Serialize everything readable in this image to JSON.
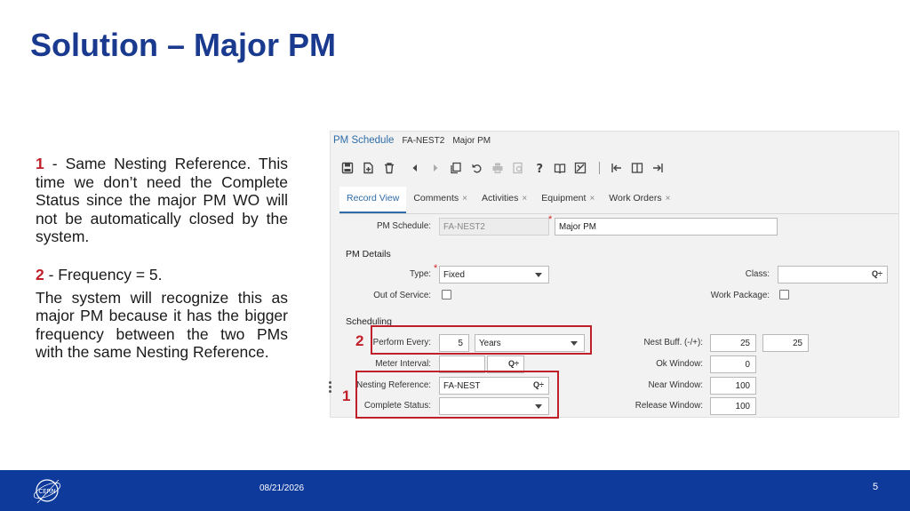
{
  "slide": {
    "title": "Solution – Major PM",
    "paragraph1_num": "1",
    "paragraph1_text": " - Same Nesting Reference. This time we don’t need the Complete Status since the major PM WO will not be automatically closed by the system.",
    "paragraph2_num": "2",
    "paragraph2_text": " - Frequency = 5.",
    "paragraph3_text": "The system will recognize this as major PM because it has the bigger frequency between the two PMs with the same Nesting Reference."
  },
  "screen": {
    "header": {
      "title": "PM Schedule",
      "code": "FA-NEST2",
      "name": "Major PM"
    },
    "toolbar_icons": [
      "save-icon",
      "new-record-icon",
      "delete-icon",
      "previous-icon",
      "next-icon",
      "copy-icon",
      "undo-icon",
      "print-icon",
      "print-preview-icon",
      "help-icon",
      "book-icon",
      "clear-icon",
      "first-panel-icon",
      "split-panel-icon",
      "last-panel-icon"
    ],
    "tabs": [
      {
        "label": "Record View",
        "closable": false
      },
      {
        "label": "Comments",
        "closable": true
      },
      {
        "label": "Activities",
        "closable": true
      },
      {
        "label": "Equipment",
        "closable": true
      },
      {
        "label": "Work Orders",
        "closable": true
      }
    ],
    "tab_close_glyph": "×",
    "pm_schedule": {
      "label": "PM Schedule:",
      "code": "FA-NEST2",
      "description": "Major PM"
    },
    "pm_details": {
      "section": "PM Details",
      "type_label": "Type:",
      "type_value": "Fixed",
      "out_of_service_label": "Out of Service:",
      "out_of_service_checked": false,
      "class_label": "Class:",
      "class_value": "",
      "work_package_label": "Work Package:",
      "work_package_checked": false
    },
    "scheduling": {
      "section": "Scheduling",
      "perform_every_label": "Perform Every:",
      "perform_every_value": "5",
      "perform_every_unit": "Years",
      "meter_interval_label": "Meter Interval:",
      "meter_interval_value": "",
      "meter_unit_value": "",
      "nesting_reference_label": "Nesting Reference:",
      "nesting_reference_value": "FA-NEST",
      "complete_status_label": "Complete Status:",
      "complete_status_value": "",
      "nest_buff_label": "Nest Buff. (-/+):",
      "nest_buff_minus": "25",
      "nest_buff_plus": "25",
      "ok_window_label": "Ok Window:",
      "ok_window_value": "0",
      "near_window_label": "Near Window:",
      "near_window_value": "100",
      "release_window_label": "Release Window:",
      "release_window_value": "100"
    },
    "lookup_glyph": "Q÷",
    "required_glyph": "*"
  },
  "callouts": {
    "perform_every_num": "2",
    "nesting_num": "1"
  },
  "footer": {
    "date": "08/21/2026",
    "page": "5",
    "logo_text": "CERN"
  },
  "colors": {
    "title": "#1a3a8f",
    "footer": "#0e3a9c",
    "highlight": "#c0202a",
    "link": "#2f6ca8"
  }
}
